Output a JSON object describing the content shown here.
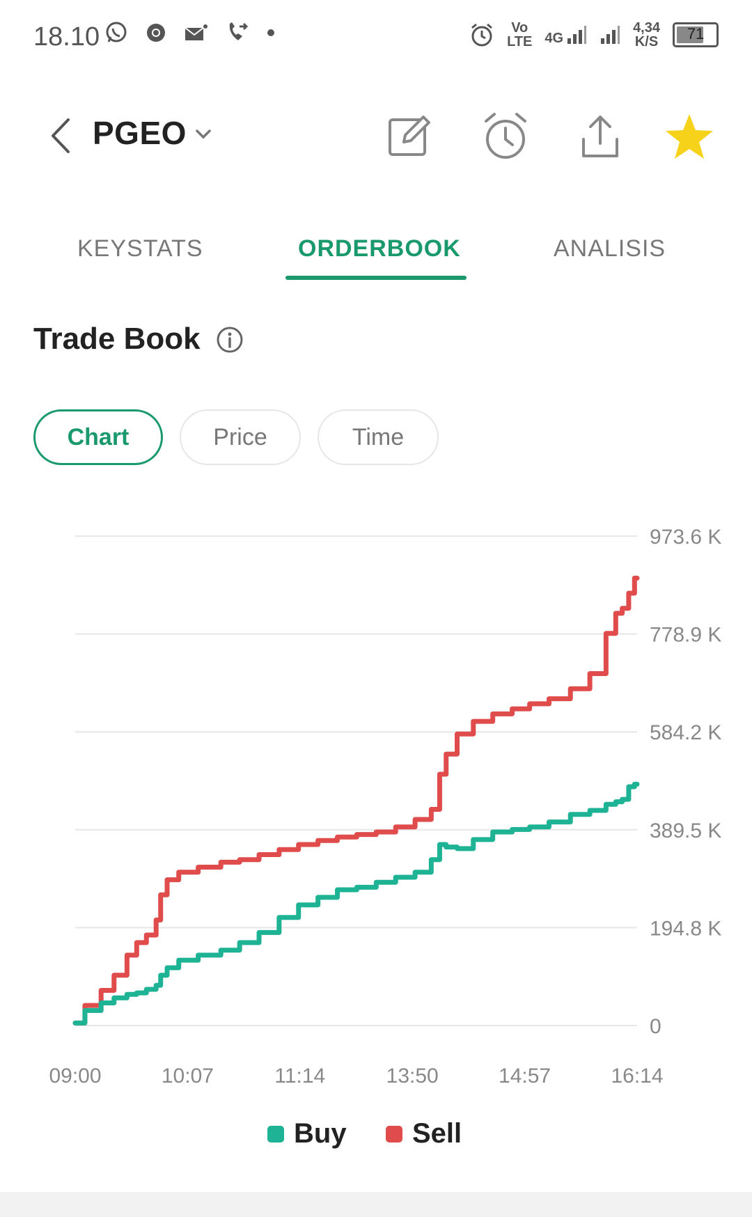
{
  "status_bar": {
    "time": "18.10",
    "left_icons": [
      "whatsapp-icon",
      "chrome-icon",
      "mail-icon",
      "call-forward-icon",
      "dot-icon"
    ],
    "network": {
      "volte_line1": "Vo",
      "volte_line2": "LTE",
      "lte": "4G",
      "speed_value": "4,34",
      "speed_unit": "K/S"
    },
    "battery_percent": 71,
    "battery_label": "71"
  },
  "header": {
    "ticker": "PGEO",
    "icons": [
      "edit-icon",
      "alarm-icon",
      "share-icon",
      "star-icon"
    ]
  },
  "tabs": [
    {
      "label": "KEYSTATS",
      "active": false
    },
    {
      "label": "ORDERBOOK",
      "active": true
    },
    {
      "label": "ANALISIS",
      "active": false
    }
  ],
  "section": {
    "title": "Trade Book"
  },
  "toggle": [
    {
      "label": "Chart",
      "active": true
    },
    {
      "label": "Price",
      "active": false
    },
    {
      "label": "Time",
      "active": false
    }
  ],
  "colors": {
    "accent": "#1a9a6c",
    "buy": "#1db394",
    "sell": "#e04b4b",
    "star": "#f6d21a"
  },
  "chart_data": {
    "type": "line",
    "x": [
      "09:00",
      "09:15",
      "09:25",
      "09:35",
      "09:45",
      "09:50",
      "10:00",
      "10:05",
      "10:07",
      "10:15",
      "10:25",
      "10:45",
      "11:00",
      "11:14",
      "11:30",
      "11:45",
      "12:00",
      "12:15",
      "12:30",
      "12:45",
      "13:00",
      "13:15",
      "13:30",
      "13:40",
      "13:43",
      "13:50",
      "14:00",
      "14:15",
      "14:30",
      "14:45",
      "14:57",
      "15:15",
      "15:30",
      "15:45",
      "15:55",
      "16:00",
      "16:05",
      "16:10",
      "16:14"
    ],
    "xlim": [
      "09:00",
      "16:14"
    ],
    "xticks": [
      "09:00",
      "10:07",
      "11:14",
      "13:50",
      "14:57",
      "16:14"
    ],
    "ylim": [
      0,
      973.6
    ],
    "yticks": [
      "0",
      "194.8 K",
      "389.5 K",
      "584.2 K",
      "778.9 K",
      "973.6 K"
    ],
    "grid": true,
    "legend": "bottom-center",
    "series": [
      {
        "name": "Buy",
        "values": [
          5,
          30,
          45,
          55,
          62,
          65,
          72,
          80,
          100,
          115,
          130,
          140,
          150,
          165,
          185,
          215,
          240,
          255,
          270,
          275,
          285,
          295,
          305,
          330,
          360,
          355,
          352,
          370,
          385,
          390,
          395,
          405,
          420,
          428,
          440,
          445,
          450,
          475,
          480
        ]
      },
      {
        "name": "Sell",
        "values": [
          5,
          40,
          70,
          100,
          140,
          165,
          180,
          210,
          260,
          290,
          305,
          315,
          325,
          330,
          340,
          350,
          360,
          368,
          375,
          380,
          385,
          395,
          410,
          430,
          500,
          540,
          580,
          605,
          620,
          630,
          640,
          650,
          670,
          700,
          780,
          820,
          830,
          860,
          890
        ]
      }
    ]
  },
  "legend": [
    {
      "name": "Buy",
      "color": "#1db394"
    },
    {
      "name": "Sell",
      "color": "#e04b4b"
    }
  ]
}
